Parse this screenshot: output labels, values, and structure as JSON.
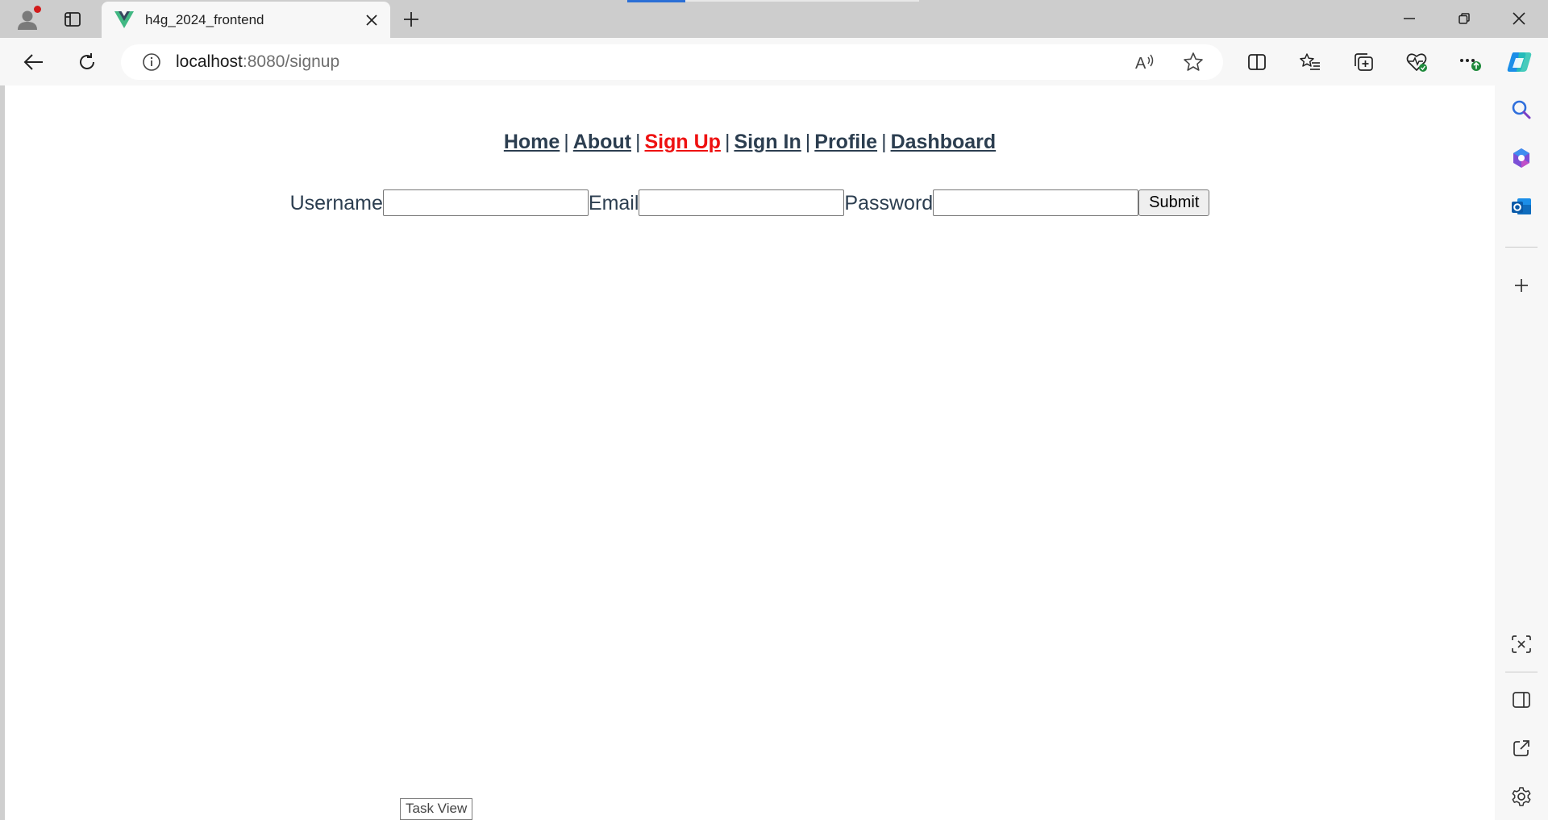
{
  "browser": {
    "tab": {
      "title": "h4g_2024_frontend"
    },
    "address": {
      "host": "localhost",
      "path": ":8080/signup"
    }
  },
  "nav": {
    "home": "Home",
    "about": "About",
    "signup": "Sign Up",
    "signin": "Sign In",
    "profile": "Profile",
    "dashboard": "Dashboard",
    "separator": "|"
  },
  "form": {
    "username_label": "Username",
    "username_value": "",
    "email_label": "Email",
    "email_value": "",
    "password_label": "Password",
    "password_value": "",
    "submit_label": "Submit"
  },
  "tooltip": {
    "text": "Task View"
  },
  "colors": {
    "nav_text": "#2c3e50",
    "nav_active": "#ee1111",
    "vue_green": "#41b883",
    "vue_dark": "#35495e"
  }
}
